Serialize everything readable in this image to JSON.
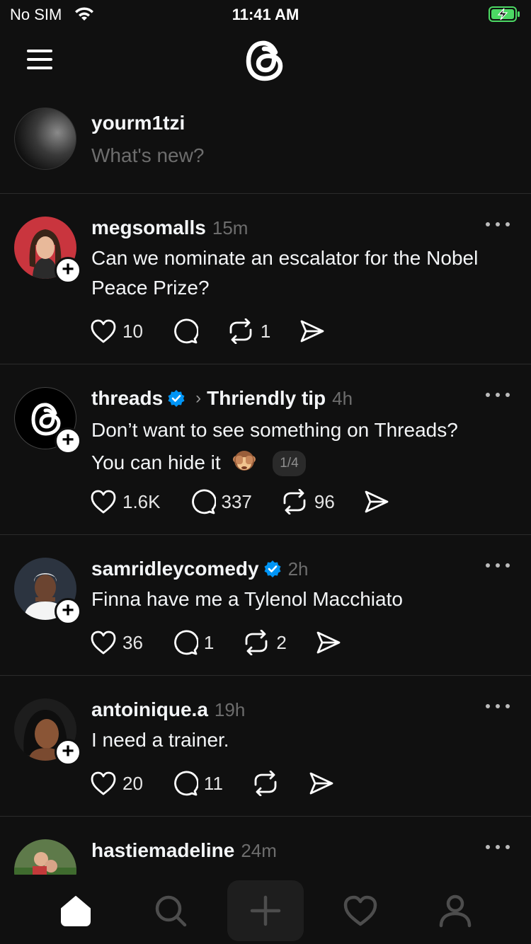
{
  "status_bar": {
    "carrier": "No SIM",
    "time": "11:41 AM"
  },
  "header": {
    "logo": "threads-logo-icon",
    "menu_icon": "hamburger-menu-icon"
  },
  "compose": {
    "username": "yourm1tzi",
    "placeholder": "What's new?"
  },
  "posts": [
    {
      "username": "megsomalls",
      "time": "15m",
      "text": "Can we nominate an escalator for the Nobel Peace Prize?",
      "likes": "10",
      "replies": "",
      "reposts": "1"
    },
    {
      "username": "threads",
      "verified": true,
      "topic": "Thriendly tip",
      "time": "4h",
      "text_line1": "Don’t want to see something on Threads?",
      "text_line2": "You can hide it",
      "emoji": "see-no-evil-monkey-icon",
      "pager": "1/4",
      "likes": "1.6K",
      "replies": "337",
      "reposts": "96"
    },
    {
      "username": "samridleycomedy",
      "verified": true,
      "time": "2h",
      "text": "Finna have me a Tylenol Macchiato",
      "likes": "36",
      "replies": "1",
      "reposts": "2"
    },
    {
      "username": "antoinique.a",
      "time": "19h",
      "text": "I need a trainer.",
      "likes": "20",
      "replies": "11",
      "reposts": ""
    },
    {
      "username": "hastiemadeline",
      "time": "24m"
    }
  ],
  "tabbar": {
    "items": [
      "home-icon",
      "search-icon",
      "new-thread-icon",
      "activity-heart-icon",
      "profile-icon"
    ],
    "active": "home-icon"
  },
  "colors": {
    "background": "#101010",
    "text": "#f3f5f7",
    "muted": "#6d6d6d",
    "verified": "#0095f6",
    "battery": "#4cd964"
  }
}
